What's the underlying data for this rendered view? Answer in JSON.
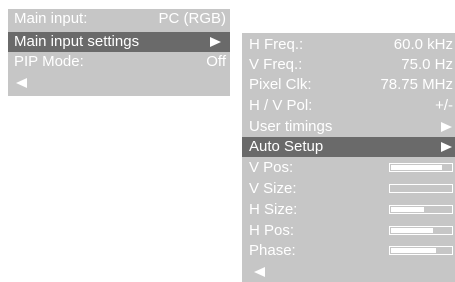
{
  "colors": {
    "panel_bg": "#c6c6c6",
    "selected_bg": "#6a6a6a",
    "text": "#ffffff"
  },
  "main_menu": {
    "main_input_label": "Main input:",
    "main_input_value": "PC (RGB)",
    "main_input_settings_label": "Main input settings",
    "main_input_settings_arrow": "arrow-right-icon",
    "pip_mode_label": "PIP Mode:",
    "pip_mode_value": "Off",
    "back_arrow": "arrow-left-icon",
    "selected": "Main input settings"
  },
  "settings_menu": {
    "h_freq_label": "H Freq.:",
    "h_freq_value": "60.0 kHz",
    "v_freq_label": "V Freq.:",
    "v_freq_value": "75.0 Hz",
    "pixel_clk_label": "Pixel Clk:",
    "pixel_clk_value": "78.75 MHz",
    "hv_pol_label": "H / V Pol:",
    "hv_pol_value": "+/-",
    "user_timings_label": "User timings",
    "auto_setup_label": "Auto Setup",
    "selected": "Auto Setup",
    "adjustments": [
      {
        "label": "V Pos:",
        "level": 0.85
      },
      {
        "label": "V Size:",
        "level": 0.0
      },
      {
        "label": "H Size:",
        "level": 0.55
      },
      {
        "label": "H Pos:",
        "level": 0.7
      },
      {
        "label": "Phase:",
        "level": 0.75
      }
    ],
    "back_arrow": "arrow-left-icon"
  }
}
